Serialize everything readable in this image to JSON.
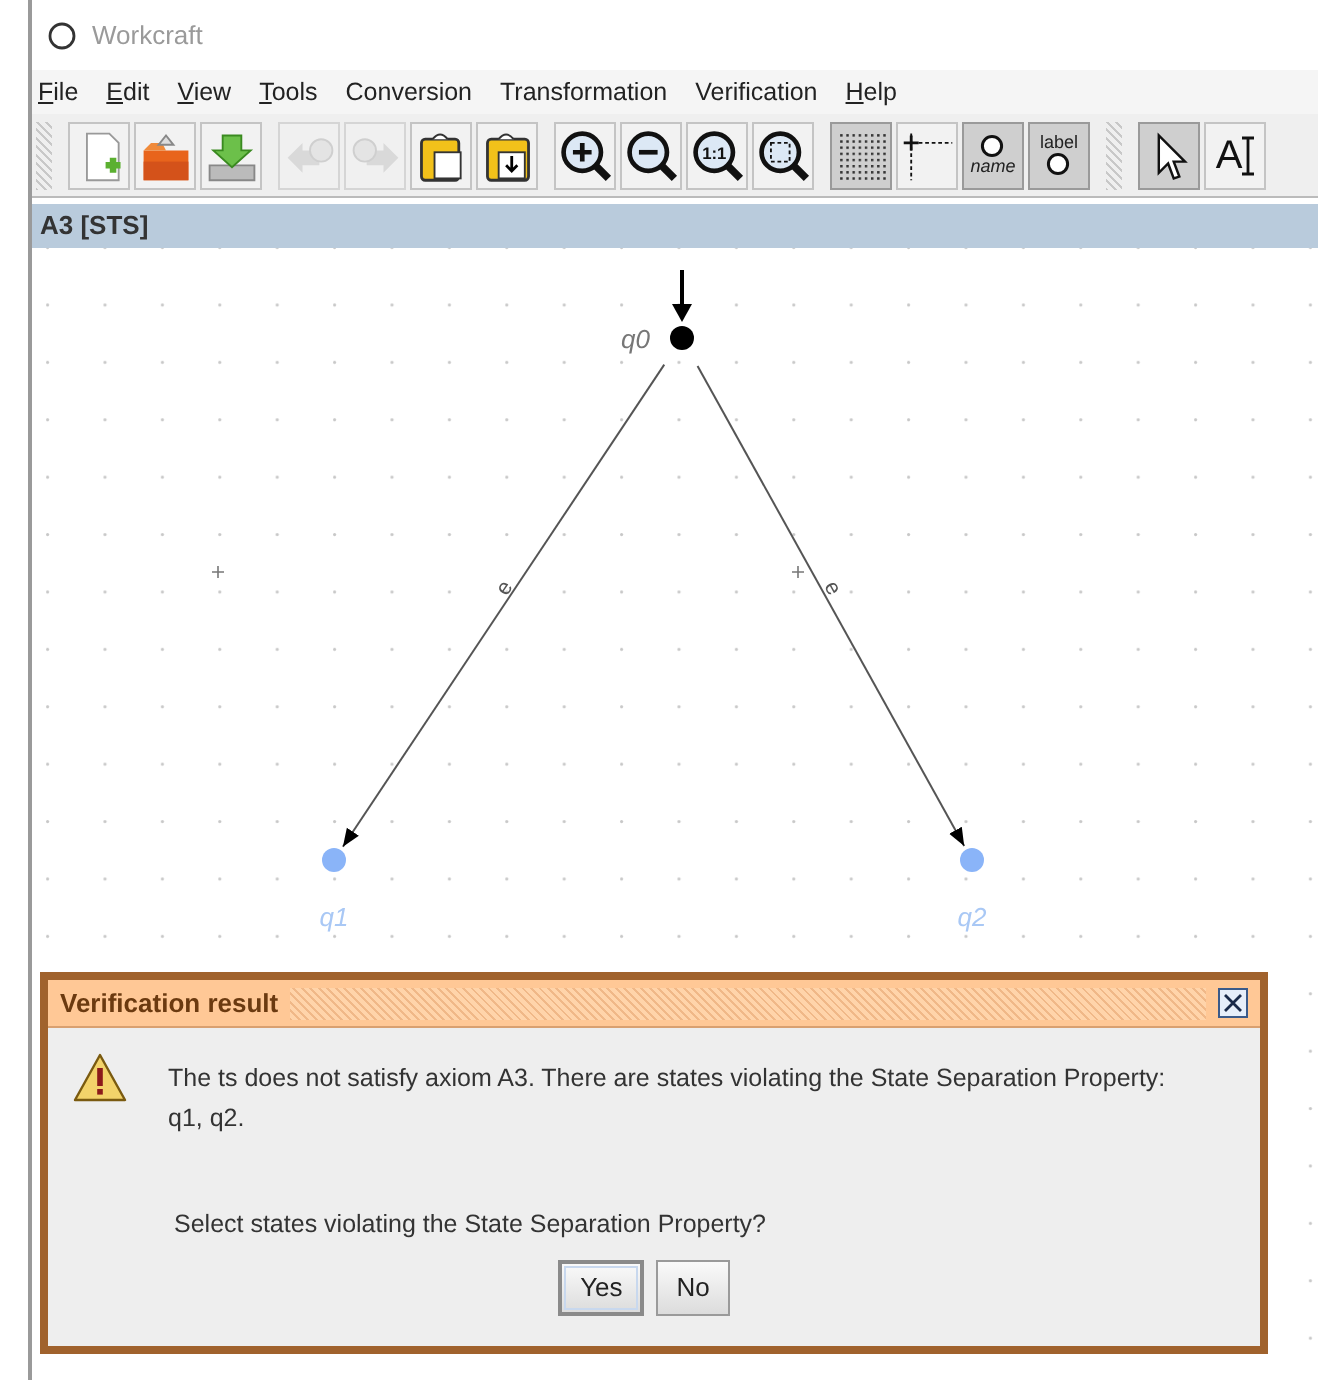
{
  "window": {
    "title": "Workcraft"
  },
  "menu": [
    {
      "label": "File",
      "underlined_first_letter": true
    },
    {
      "label": "Edit",
      "underlined_first_letter": true
    },
    {
      "label": "View",
      "underlined_first_letter": true
    },
    {
      "label": "Tools",
      "underlined_first_letter": true
    },
    {
      "label": "Conversion",
      "underlined_first_letter": false
    },
    {
      "label": "Transformation",
      "underlined_first_letter": false
    },
    {
      "label": "Verification",
      "underlined_first_letter": false
    },
    {
      "label": "Help",
      "underlined_first_letter": true
    }
  ],
  "toolbar": [
    [
      {
        "kind": "new",
        "disabled": false,
        "selected": false
      },
      {
        "kind": "open",
        "disabled": false,
        "selected": false
      },
      {
        "kind": "save",
        "disabled": false,
        "selected": false
      }
    ],
    [
      {
        "kind": "undo",
        "disabled": true,
        "selected": false
      },
      {
        "kind": "redo",
        "disabled": true,
        "selected": false
      },
      {
        "kind": "paste",
        "disabled": false,
        "selected": false
      },
      {
        "kind": "paste-into",
        "disabled": false,
        "selected": false
      }
    ],
    [
      {
        "kind": "zoom-in",
        "disabled": false,
        "selected": false
      },
      {
        "kind": "zoom-out",
        "disabled": false,
        "selected": false
      },
      {
        "kind": "zoom-actual",
        "disabled": false,
        "selected": false,
        "text": "1:1"
      },
      {
        "kind": "zoom-fit",
        "disabled": false,
        "selected": false
      }
    ],
    [
      {
        "kind": "grid",
        "disabled": false,
        "selected": true
      },
      {
        "kind": "ruler",
        "disabled": false,
        "selected": false
      },
      {
        "kind": "name",
        "disabled": false,
        "selected": true,
        "text": "name"
      },
      {
        "kind": "label",
        "disabled": false,
        "selected": true,
        "text": "label"
      }
    ],
    [
      {
        "kind": "select",
        "disabled": false,
        "selected": true
      },
      {
        "kind": "text",
        "disabled": false,
        "selected": false,
        "text": "A"
      }
    ]
  ],
  "tab": {
    "title": "A3 [STS]"
  },
  "canvas": {
    "states": [
      {
        "name": "q0",
        "initial": true,
        "color": "#000000"
      },
      {
        "name": "q1",
        "initial": false,
        "color": "#8ab4f8"
      },
      {
        "name": "q2",
        "initial": false,
        "color": "#8ab4f8"
      }
    ],
    "transitions": [
      {
        "label": "e"
      },
      {
        "label": "e"
      }
    ]
  },
  "dialog": {
    "title": "Verification result",
    "message_lines": [
      "The ts does not satisfy axiom A3. There are states violating the State Separation Property:",
      "q1, q2."
    ],
    "question": "Select states violating the State Separation Property?",
    "buttons": [
      {
        "label": "Yes",
        "selected": true
      },
      {
        "label": "No",
        "selected": false
      }
    ]
  }
}
